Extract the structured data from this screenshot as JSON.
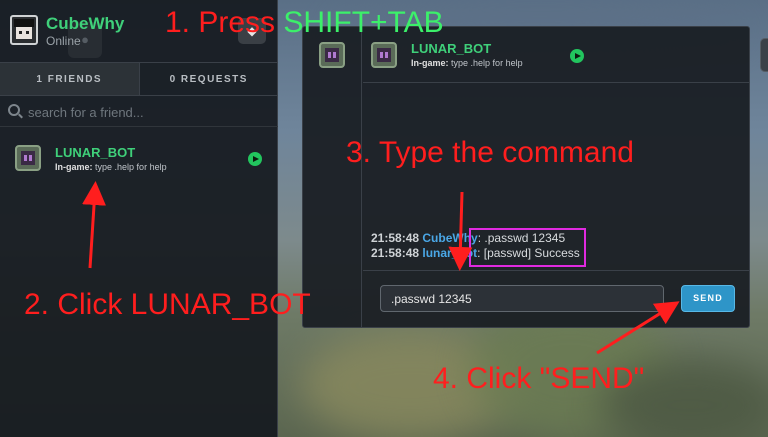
{
  "profile": {
    "username": "CubeWhy",
    "status": "Online"
  },
  "tabs": [
    {
      "label": "1 FRIENDS"
    },
    {
      "label": "0 REQUESTS"
    }
  ],
  "search": {
    "placeholder": "search for a friend..."
  },
  "friends": [
    {
      "name": "LUNAR_BOT",
      "activity_prefix": "In-game:",
      "activity": "type .help for help"
    }
  ],
  "chat": {
    "header": {
      "name": "LUNAR_BOT",
      "activity_prefix": "In-game:",
      "activity": "type .help for help",
      "close_label": "✕"
    },
    "messages": [
      {
        "time": "21:58:48",
        "sender": "CubeWhy",
        "text": ".passwd 12345"
      },
      {
        "time": "21:58:48",
        "sender": "lunar_bot",
        "text": "[passwd] Success"
      }
    ],
    "input_value": ".passwd 12345",
    "send_label": "SEND"
  },
  "annotations": {
    "step1_prefix": "1. Press ",
    "step1_keys": "SHIFT+TAB",
    "step2": "2. Click LUNAR_BOT",
    "step3": "3. Type the command",
    "step4": "4. Click \"SEND\""
  },
  "colors": {
    "online_green": "#3fd07a",
    "annotation_red": "#ff1e1e",
    "annotation_green": "#3cf06a",
    "highlight_magenta": "#e02ae0",
    "send_blue": "#2e95c8"
  }
}
